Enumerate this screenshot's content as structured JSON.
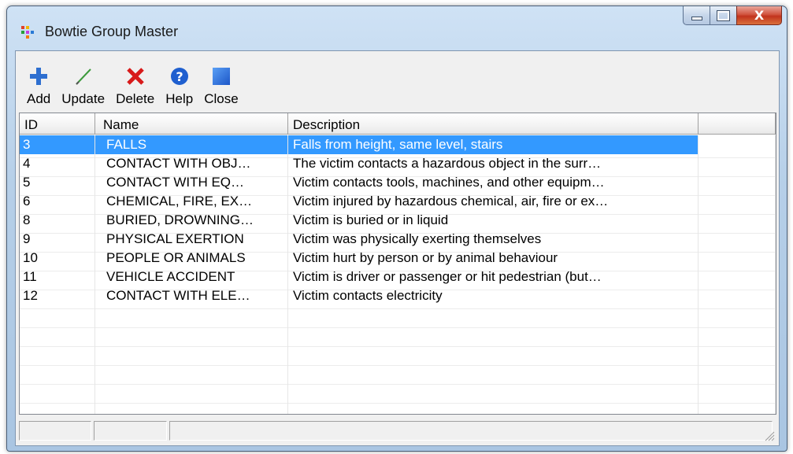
{
  "window": {
    "title": "Bowtie Group Master"
  },
  "caption_buttons": {
    "close_label": "X"
  },
  "toolbar": [
    {
      "id": "add",
      "label": "Add",
      "icon": "add-plus-icon"
    },
    {
      "id": "update",
      "label": "Update",
      "icon": "pencil-icon"
    },
    {
      "id": "delete",
      "label": "Delete",
      "icon": "red-x-icon"
    },
    {
      "id": "help",
      "label": "Help",
      "icon": "question-circle-icon"
    },
    {
      "id": "close",
      "label": "Close",
      "icon": "blue-square-icon"
    }
  ],
  "list": {
    "columns": [
      "ID",
      "Name",
      "Description",
      ""
    ],
    "selected_id": "3",
    "rows": [
      {
        "id": "3",
        "name": "FALLS",
        "description": "Falls from height, same level, stairs"
      },
      {
        "id": "4",
        "name": "CONTACT WITH OBJ…",
        "description": "The victim contacts a hazardous object in the surr…"
      },
      {
        "id": "5",
        "name": "CONTACT WITH EQ…",
        "description": "Victim contacts tools, machines, and other equipm…"
      },
      {
        "id": "6",
        "name": "CHEMICAL, FIRE, EX…",
        "description": "Victim injured by hazardous chemical, air, fire or ex…"
      },
      {
        "id": "8",
        "name": "BURIED, DROWNING…",
        "description": "Victim is buried or in liquid"
      },
      {
        "id": "9",
        "name": "PHYSICAL EXERTION",
        "description": "Victim was physically exerting themselves"
      },
      {
        "id": "10",
        "name": "PEOPLE OR ANIMALS",
        "description": "Victim hurt by person or by animal behaviour"
      },
      {
        "id": "11",
        "name": "VEHICLE ACCIDENT",
        "description": "Victim is  driver or passenger or hit pedestrian (but…"
      },
      {
        "id": "12",
        "name": "CONTACT WITH ELE…",
        "description": "Victim contacts electricity"
      }
    ]
  },
  "colors": {
    "selection": "#3399ff",
    "add_icon": "#2e6fd0",
    "delete_icon": "#d81a1a",
    "help_icon": "#1f5fcf"
  }
}
